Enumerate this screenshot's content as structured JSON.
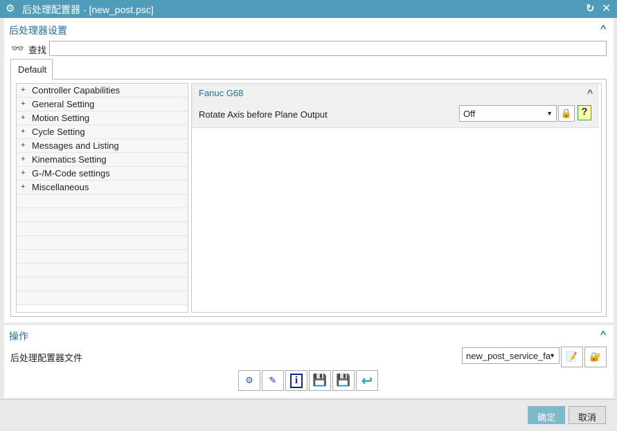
{
  "window": {
    "title": "后处理配置器 - [new_post.psc]",
    "icons": [
      "gear-icon",
      "refresh-icon",
      "close-icon"
    ]
  },
  "settings": {
    "title": "后处理器设置",
    "search_label": "查找",
    "search_value": "",
    "tab": "Default"
  },
  "tree": [
    "Controller Capabilities",
    "General Setting",
    "Motion Setting",
    "Cycle Setting",
    "Messages and Listing",
    "Kinematics Setting",
    "G-/M-Code settings",
    "Miscellaneous"
  ],
  "group": {
    "title": "Fanuc G68",
    "label": "Rotate Axis before Plane Output",
    "value": "Off"
  },
  "ops": {
    "title": "操作",
    "file_label": "后处理配置器文件",
    "file_value": "new_post_service_fa"
  },
  "buttons": {
    "ok": "确定",
    "cancel": "取消"
  },
  "colors": {
    "titlebar": "#4f9cba",
    "accent": "#1f6f9a"
  }
}
